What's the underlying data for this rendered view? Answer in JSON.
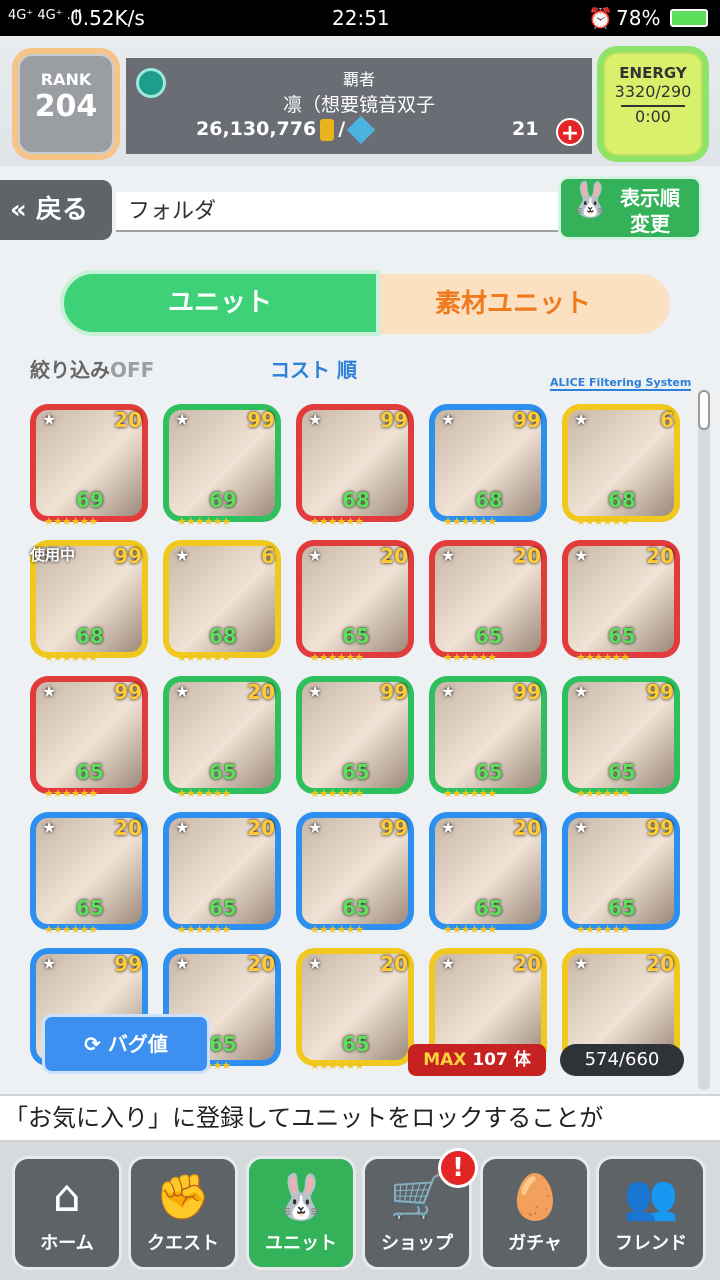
{
  "status_bar": {
    "network": "4G⁺ 4G⁺ .ıll",
    "speed": "0.52K/s",
    "time": "22:51",
    "battery": "78%"
  },
  "header": {
    "rank_label": "RANK",
    "rank_value": "204",
    "title": "覇者",
    "player_name": "凛（想要镜音双子",
    "coins": "26,130,776",
    "separator": "/",
    "stamina_items": "21",
    "energy_label": "ENERGY",
    "energy_value": "3320/290",
    "energy_timer": "0:00"
  },
  "nav": {
    "back_label": "戻る",
    "folder_label": "フォルダ",
    "sort_button_label": "表示順変更"
  },
  "tabs": {
    "unit": "ユニット",
    "material": "素材ユニット"
  },
  "filter": {
    "filter_label": "絞り込み",
    "filter_state": "OFF",
    "sort_label": "コスト 順",
    "system_label": "ALICE Filtering System"
  },
  "units": [
    {
      "count": "20",
      "level": "69",
      "frame": "red"
    },
    {
      "count": "99",
      "level": "69",
      "frame": "green"
    },
    {
      "count": "99",
      "level": "68",
      "frame": "red"
    },
    {
      "count": "99",
      "level": "68",
      "frame": "blue"
    },
    {
      "count": "6",
      "level": "68",
      "frame": "yellow"
    },
    {
      "count": "99",
      "level": "68",
      "frame": "yellow",
      "status": "使用中"
    },
    {
      "count": "6",
      "level": "68",
      "frame": "yellow"
    },
    {
      "count": "20",
      "level": "65",
      "frame": "red"
    },
    {
      "count": "20",
      "level": "65",
      "frame": "red"
    },
    {
      "count": "20",
      "level": "65",
      "frame": "red"
    },
    {
      "count": "99",
      "level": "65",
      "frame": "red"
    },
    {
      "count": "20",
      "level": "65",
      "frame": "green"
    },
    {
      "count": "99",
      "level": "65",
      "frame": "green"
    },
    {
      "count": "99",
      "level": "65",
      "frame": "green"
    },
    {
      "count": "99",
      "level": "65",
      "frame": "green"
    },
    {
      "count": "20",
      "level": "65",
      "frame": "blue"
    },
    {
      "count": "20",
      "level": "65",
      "frame": "blue"
    },
    {
      "count": "99",
      "level": "65",
      "frame": "blue"
    },
    {
      "count": "20",
      "level": "65",
      "frame": "blue"
    },
    {
      "count": "99",
      "level": "65",
      "frame": "blue"
    },
    {
      "count": "99",
      "level": "",
      "frame": "blue"
    },
    {
      "count": "20",
      "level": "65",
      "frame": "blue"
    },
    {
      "count": "20",
      "level": "65",
      "frame": "yellow"
    },
    {
      "count": "20",
      "level": "",
      "frame": "yellow"
    },
    {
      "count": "20",
      "level": "",
      "frame": "yellow"
    }
  ],
  "overlays": {
    "bug_button": "バグ値",
    "max_label": "MAX",
    "max_value": "107 体",
    "unit_count": "574/660"
  },
  "ticker": "「お気に入り」に登録してユニットをロックすることが",
  "bottom_nav": [
    {
      "label": "ホーム",
      "icon": "home-icon"
    },
    {
      "label": "クエスト",
      "icon": "handshake-icon"
    },
    {
      "label": "ユニット",
      "icon": "bunny-icon"
    },
    {
      "label": "ショップ",
      "icon": "cart-icon"
    },
    {
      "label": "ガチャ",
      "icon": "egg-icon"
    },
    {
      "label": "フレンド",
      "icon": "friends-icon"
    }
  ],
  "shop_notification": "!"
}
